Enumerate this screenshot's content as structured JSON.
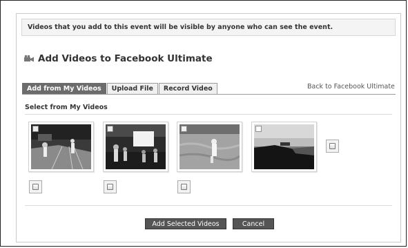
{
  "dialog": {
    "notice": "Videos that you add to this event will be visible by anyone who can see the event.",
    "title": "Add Videos to Facebook Ultimate",
    "title_icon": "video-camera-icon"
  },
  "tabs": [
    {
      "label": "Add from My Videos",
      "active": true
    },
    {
      "label": "Upload File",
      "active": false
    },
    {
      "label": "Record Video",
      "active": false
    }
  ],
  "back_link": "Back to Facebook Ultimate",
  "section_label": "Select from My Videos",
  "videos": [
    {
      "name": "video-1",
      "checked": false
    },
    {
      "name": "video-2",
      "checked": false
    },
    {
      "name": "video-3",
      "checked": false
    },
    {
      "name": "video-4",
      "checked": false
    }
  ],
  "buttons": {
    "add_selected": "Add Selected Videos",
    "cancel": "Cancel"
  }
}
